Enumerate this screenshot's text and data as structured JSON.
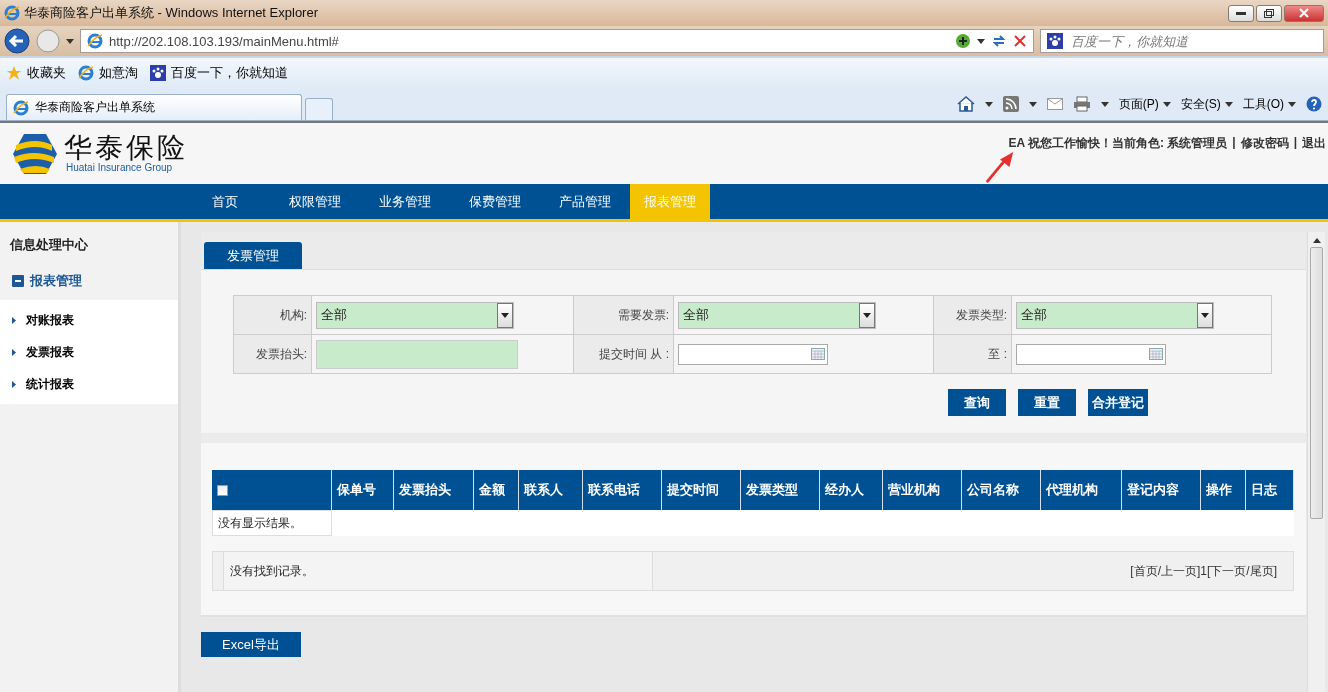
{
  "window": {
    "title": "华泰商险客户出单系统 - Windows Internet Explorer"
  },
  "address_bar": {
    "url": "http://202.108.103.193/mainMenu.html#",
    "search_placeholder": "百度一下，你就知道"
  },
  "favorites_bar": {
    "items": [
      "收藏夹",
      "如意淘",
      "百度一下，你就知道"
    ]
  },
  "browser_tabs": [
    {
      "label": "华泰商险客户出单系统",
      "selected": true
    }
  ],
  "command_bar": [
    "页面(P)",
    "安全(S)",
    "工具(O)"
  ],
  "header": {
    "logo_text": "华泰保险",
    "logo_subtitle": "Huatai Insurance Group",
    "user_info": "EA 祝您工作愉快！当前角色: 系统管理员",
    "separator": "|",
    "links": [
      "修改密码",
      "退出"
    ]
  },
  "nav": [
    {
      "label": "首页",
      "selected": false
    },
    {
      "label": "权限管理",
      "selected": false
    },
    {
      "label": "业务管理",
      "selected": false
    },
    {
      "label": "保费管理",
      "selected": false
    },
    {
      "label": "产品管理",
      "selected": false
    },
    {
      "label": "报表管理",
      "selected": true
    }
  ],
  "sidebar": {
    "title": "信息处理中心",
    "group": {
      "label": "报表管理",
      "expanded": true,
      "children": [
        "对账报表",
        "发票报表",
        "统计报表"
      ]
    }
  },
  "panel": {
    "tab": "发票管理",
    "filters": [
      {
        "label": "机构:",
        "kind": "select",
        "value": "全部"
      },
      {
        "label": "需要发票:",
        "kind": "select",
        "value": "全部"
      },
      {
        "label": "发票类型:",
        "kind": "select",
        "value": "全部"
      },
      {
        "label": "发票抬头:",
        "kind": "text"
      },
      {
        "label": "提交时间 从 :",
        "kind": "date"
      },
      {
        "label": "至 :",
        "kind": "date"
      }
    ],
    "buttons": [
      "查询",
      "重置",
      "合并登记"
    ]
  },
  "table": {
    "select_all_checked": false,
    "columns": [
      "保单号",
      "发票抬头",
      "金额",
      "联系人",
      "联系电话",
      "提交时间",
      "发票类型",
      "经办人",
      "营业机构",
      "公司名称",
      "代理机构",
      "登记内容",
      "操作",
      "日志"
    ],
    "empty_message": "没有显示结果。"
  },
  "pager": {
    "message": "没有找到记录。",
    "links": "[首页/上一页]1[下一页/尾页]"
  },
  "export_button": "Excel导出"
}
